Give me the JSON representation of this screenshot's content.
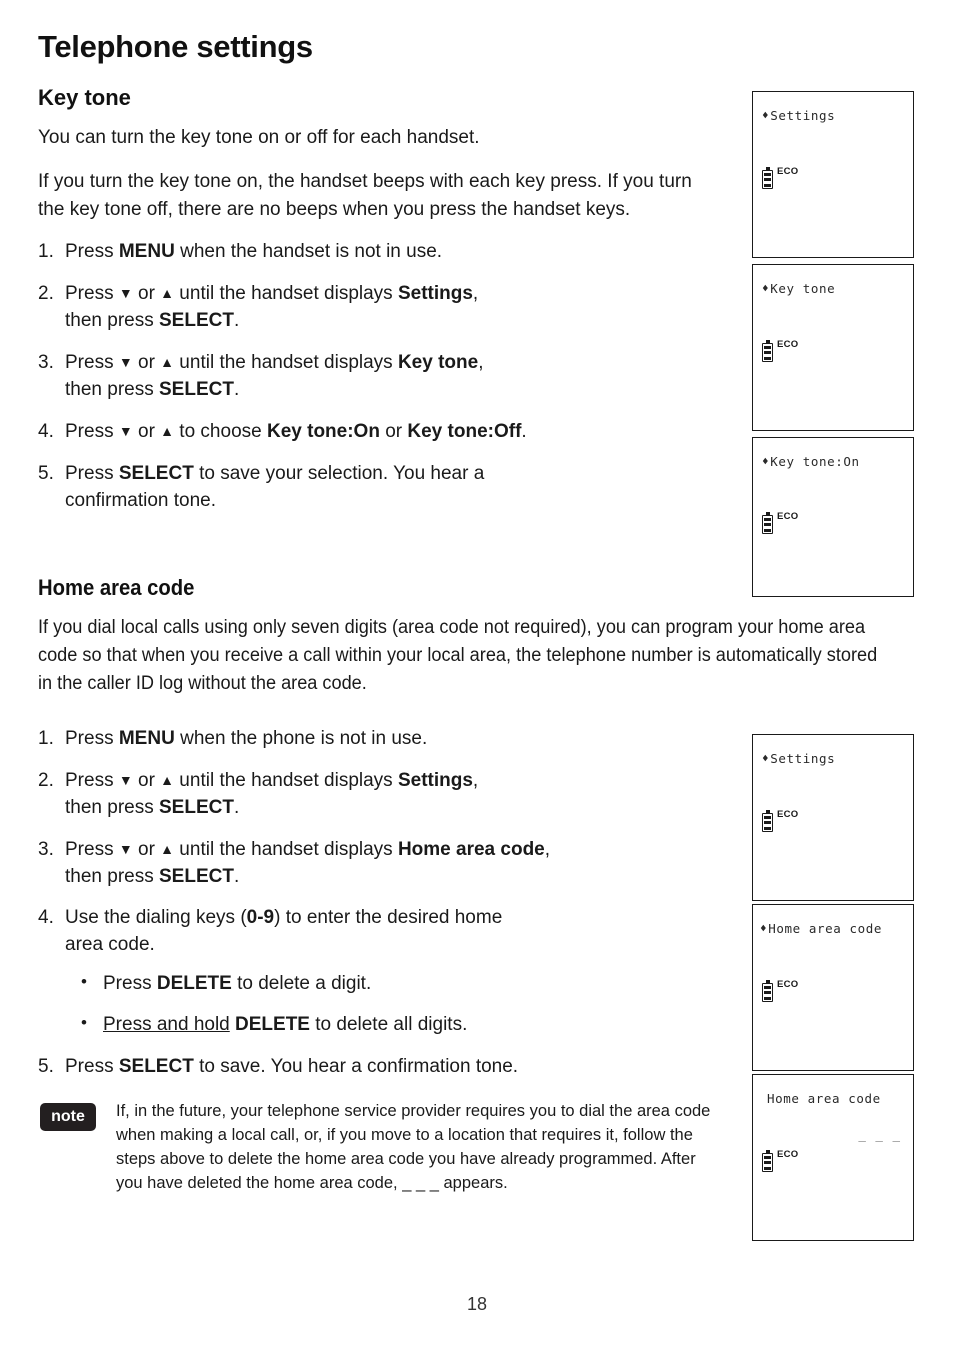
{
  "document": {
    "page_title": "Telephone settings",
    "page_number": "18"
  },
  "sections": [
    {
      "heading": "Key tone",
      "paragraphs": [
        "You can turn the key tone on or off for each handset.",
        "If you turn the key tone on, the handset beeps with each key press. If you turn the key tone off, there are no beeps when you press the handset keys."
      ],
      "steps": [
        {
          "num": "1.",
          "text": "Press MENU when the handset is not in use."
        },
        {
          "num": "2.",
          "text": "Press ▼ or ▲ until the handset displays Settings, then press SELECT."
        },
        {
          "num": "3.",
          "text": "Press ▼ or ▲ until the handset displays Key tone, then press SELECT."
        },
        {
          "num": "4.",
          "text": "Press ▼ or ▲ to choose Key tone:On or Key tone:Off."
        },
        {
          "num": "5.",
          "text": "Press SELECT to save your selection. You hear a confirmation tone."
        }
      ]
    },
    {
      "heading": "Home area code",
      "paragraphs": [
        "If you dial local calls using only seven digits (area code not required), you can program your home area code so that when you receive a call within your local area, the telephone number is automatically stored in the caller ID log without the area code."
      ],
      "steps": [
        {
          "num": "1.",
          "text": "Press MENU when the phone is not in use."
        },
        {
          "num": "2.",
          "text": "Press ▼ or ▲ until the handset displays Settings, then press SELECT."
        },
        {
          "num": "3.",
          "text": "Press ▼ or ▲ until the handset displays Home area code, then press SELECT."
        },
        {
          "num": "4.",
          "text": "Use the dialing keys (0-9) to enter the desired home area code."
        },
        {
          "num": "5.",
          "text": "Press SELECT to save. You hear a confirmation tone."
        }
      ],
      "sub_bullets": [
        {
          "bullet": "•",
          "text": "Press DELETE to delete a digit."
        },
        {
          "bullet": "•",
          "text": "Press and hold DELETE to delete all digits."
        }
      ]
    }
  ],
  "note": {
    "badge_label": "note",
    "text": "If, in the future, your telephone service provider requires you to dial the area code when making a local call, or, if you move to a location that requires it, follow the steps above to delete the home area code you have already programmed. After you have deleted the home area code, _ _ _ appears."
  },
  "screens": [
    {
      "id": "screen-settings-1",
      "arrow": "♦",
      "title": "Settings",
      "dashes": "",
      "eco": "ECO"
    },
    {
      "id": "screen-key-tone",
      "arrow": "♦",
      "title": "Key tone",
      "dashes": "",
      "eco": "ECO"
    },
    {
      "id": "screen-key-tone-on",
      "arrow": "♦",
      "title": "Key tone:On",
      "dashes": "",
      "eco": "ECO"
    },
    {
      "id": "screen-settings-2",
      "arrow": "♦",
      "title": "Settings",
      "dashes": "",
      "eco": "ECO"
    },
    {
      "id": "screen-home-area",
      "arrow": "♦",
      "title": "Home area code",
      "dashes": "",
      "eco": "ECO"
    },
    {
      "id": "screen-home-area-empty",
      "arrow": "",
      "title": "Home area code",
      "dashes": "_ _ _",
      "eco": "ECO"
    }
  ],
  "colors": {
    "text": "#1a1a1a",
    "note_badge_bg": "#231f20",
    "lcd_border": "#1a1a1a"
  }
}
